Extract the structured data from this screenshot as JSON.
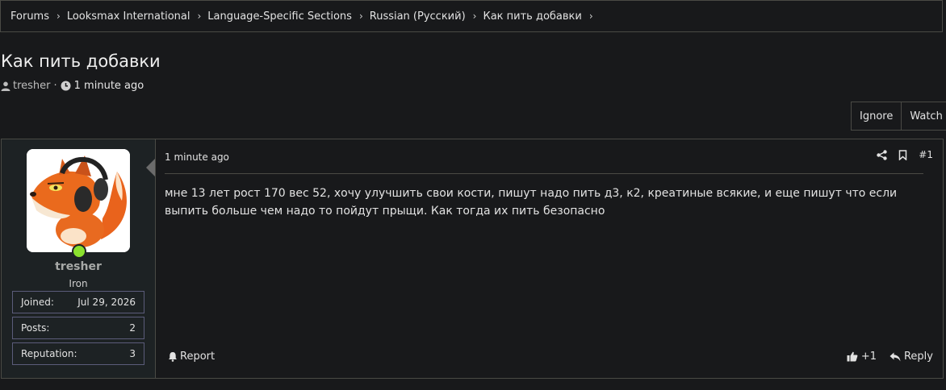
{
  "breadcrumb": [
    {
      "label": "Forums"
    },
    {
      "label": "Looksmax International"
    },
    {
      "label": "Language-Specific Sections"
    },
    {
      "label": "Russian (Русский)"
    },
    {
      "label": "Как пить добавки"
    }
  ],
  "thread": {
    "title": "Как пить добавки",
    "author": "tresher",
    "separator": "·",
    "time": "1 minute ago",
    "author_icon": "user-icon",
    "time_icon": "clock-icon"
  },
  "actions": {
    "ignore": "Ignore",
    "watch": "Watch"
  },
  "post": {
    "user": {
      "name": "tresher",
      "title": "Iron",
      "online_color": "#8be12e",
      "stats": [
        {
          "label": "Joined:",
          "value": "Jul 29, 2026"
        },
        {
          "label": "Posts:",
          "value": "2"
        },
        {
          "label": "Reputation:",
          "value": "3"
        }
      ]
    },
    "time": "1 minute ago",
    "number": "#1",
    "share_icon": "share-icon",
    "bookmark_icon": "bookmark-icon",
    "body": "мне 13 лет рост 170 вес 52, хочу улучшить свои кости, пишут надо пить д3, к2, креатиные всякие, и еще пишут что если выпить больше чем надо то пойдут прыщи. Как тогда их пить безопасно",
    "report": "Report",
    "reaction_count": "+1",
    "reply": "Reply"
  }
}
